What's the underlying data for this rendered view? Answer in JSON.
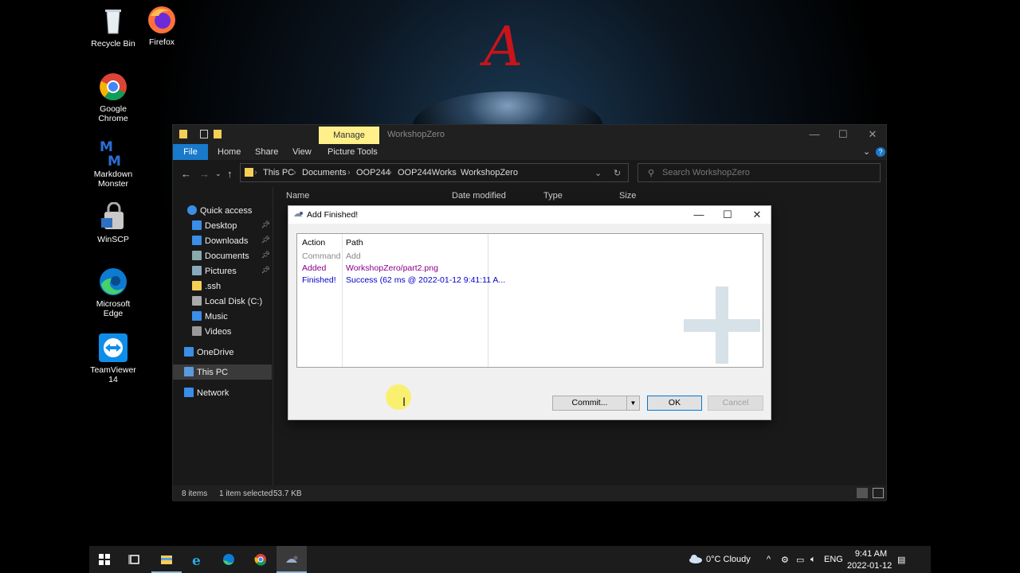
{
  "desktop": {
    "icons": [
      {
        "label": "Recycle Bin",
        "icon": "recycle-bin-icon"
      },
      {
        "label": "Firefox",
        "icon": "firefox-icon"
      },
      {
        "label": "Google Chrome",
        "icon": "chrome-icon"
      },
      {
        "label": "Markdown Monster",
        "icon": "markdown-monster-icon"
      },
      {
        "label": "WinSCP",
        "icon": "winscp-icon"
      },
      {
        "label": "Microsoft Edge",
        "icon": "edge-icon"
      },
      {
        "label": "TeamViewer 14",
        "icon": "teamviewer-icon"
      }
    ],
    "wallpaper_letter": "A"
  },
  "explorer": {
    "ribbon_context_tab": "Manage",
    "title": "WorkshopZero",
    "tabs": [
      "File",
      "Home",
      "Share",
      "View",
      "Picture Tools"
    ],
    "breadcrumb": [
      "This PC",
      "Documents",
      "OOP244",
      "OOP244Works",
      "WorkshopZero"
    ],
    "search_placeholder": "Search WorkshopZero",
    "nav": [
      {
        "label": "Quick access",
        "pinned": false
      },
      {
        "label": "Desktop",
        "pinned": true
      },
      {
        "label": "Downloads",
        "pinned": true
      },
      {
        "label": "Documents",
        "pinned": true
      },
      {
        "label": "Pictures",
        "pinned": true
      },
      {
        "label": ".ssh",
        "pinned": false
      },
      {
        "label": "Local Disk (C:)",
        "pinned": false
      },
      {
        "label": "Music",
        "pinned": false
      },
      {
        "label": "Videos",
        "pinned": false
      },
      {
        "label": "OneDrive",
        "pinned": false
      },
      {
        "label": "This PC",
        "pinned": false,
        "selected": true
      },
      {
        "label": "Network",
        "pinned": false
      }
    ],
    "columns": [
      "Name",
      "Date modified",
      "Type",
      "Size"
    ],
    "status": {
      "items": "8 items",
      "selected": "1 item selected",
      "size": "53.7 KB"
    }
  },
  "dialog": {
    "title": "Add Finished!",
    "columns": [
      "Action",
      "Path"
    ],
    "rows": [
      {
        "action": "Command",
        "path": "Add",
        "color": "#8a8a8a"
      },
      {
        "action": "Added",
        "path": "WorkshopZero/part2.png",
        "color": "#8b008b"
      },
      {
        "action": "Finished!",
        "path": "Success (62 ms @ 2022-01-12 9:41:11 A...",
        "color": "#0000c8"
      }
    ],
    "buttons": {
      "commit": "Commit...",
      "ok": "OK",
      "cancel": "Cancel"
    }
  },
  "taskbar": {
    "weather": "0°C  Cloudy",
    "lang": "ENG",
    "time": "9:41 AM",
    "date": "2022-01-12"
  }
}
